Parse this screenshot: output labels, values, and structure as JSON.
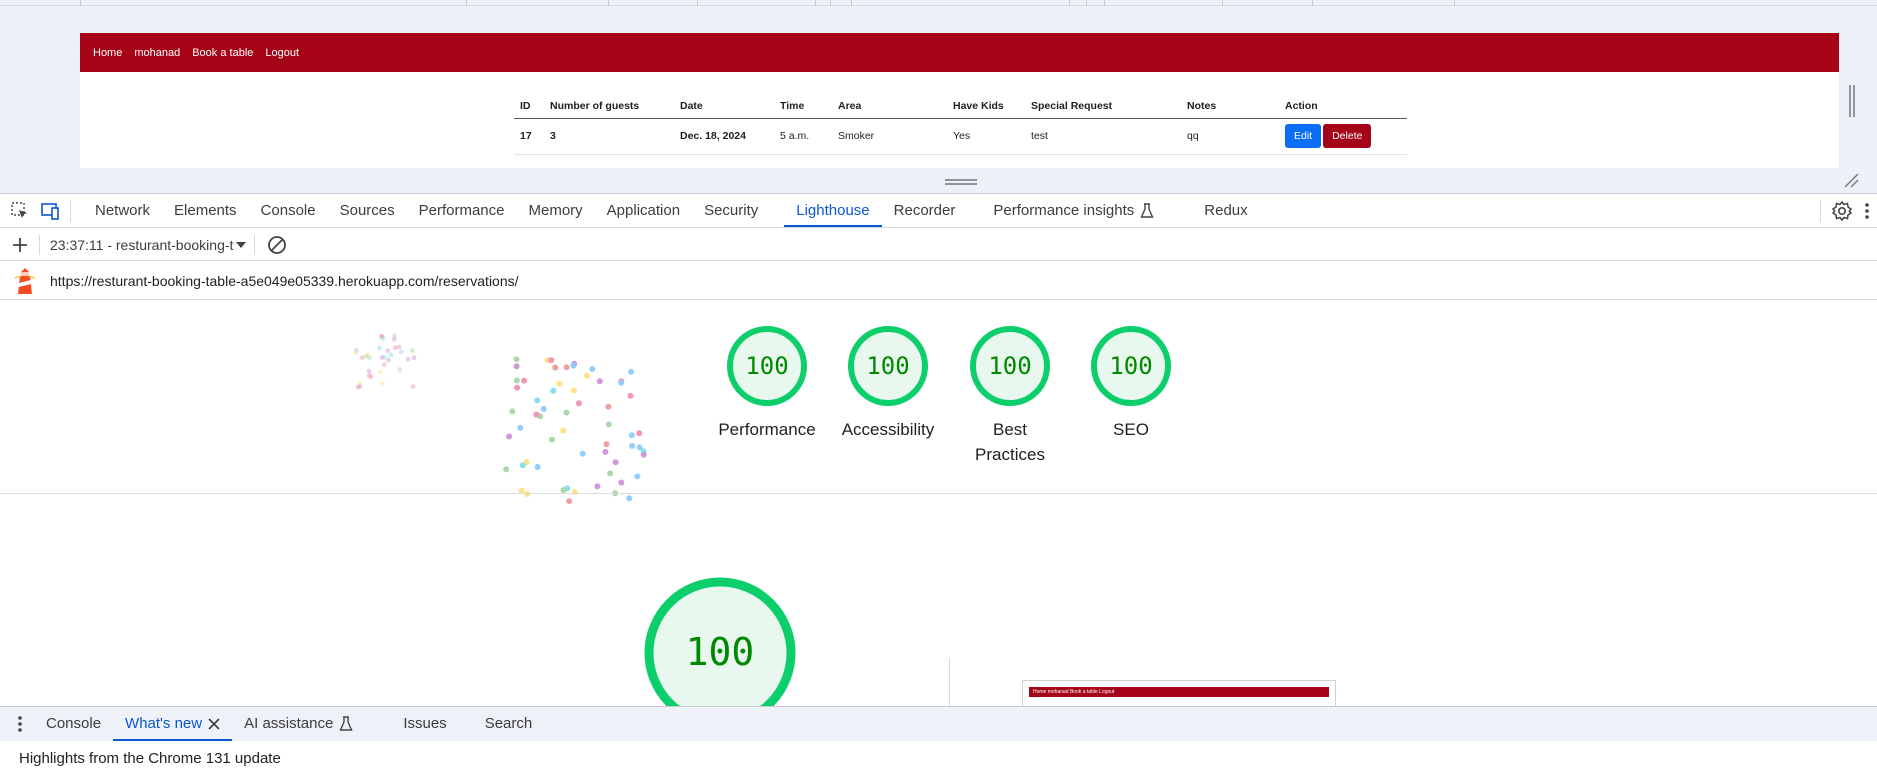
{
  "site": {
    "nav": [
      "Home",
      "mohanad",
      "Book a table",
      "Logout"
    ],
    "table": {
      "headers": [
        "ID",
        "Number of guests",
        "Date",
        "Time",
        "Area",
        "Have Kids",
        "Special Request",
        "Notes",
        "Action"
      ],
      "rows": [
        {
          "id": "17",
          "guests": "3",
          "date": "Dec. 18, 2024",
          "time": "5 a.m.",
          "area": "Smoker",
          "kids": "Yes",
          "request": "test",
          "notes": "qq",
          "edit": "Edit",
          "delete": "Delete"
        }
      ]
    }
  },
  "devtools": {
    "tabs": [
      "Network",
      "Elements",
      "Console",
      "Sources",
      "Performance",
      "Memory",
      "Application",
      "Security",
      "Lighthouse",
      "Recorder",
      "Performance insights",
      "Redux"
    ],
    "active_tab": "Lighthouse",
    "icons": {
      "inspect": "inspect-element-icon",
      "device": "device-toolbar-icon",
      "settings": "gear-icon",
      "more": "more-vert-icon",
      "flask": "experiment-flask-icon"
    }
  },
  "lighthouse": {
    "report_select": "23:37:11 - resturant-booking-t",
    "url": "https://resturant-booking-table-a5e049e05339.herokuapp.com/reservations/",
    "scores": [
      {
        "label": "Performance",
        "score": 100
      },
      {
        "label": "Accessibility",
        "score": 100
      },
      {
        "label": "Best Practices",
        "score": 100
      },
      {
        "label": "SEO",
        "score": 100
      }
    ],
    "main_score": 100,
    "colors": {
      "pass": "#0cce6b",
      "pass_fill": "#e8f8ee",
      "pass_text": "#008800"
    },
    "thumbnail_nav": "Home  mohanad  Book a table  Logout"
  },
  "drawer": {
    "tabs": [
      "Console",
      "What's new",
      "AI assistance",
      "Issues",
      "Search"
    ],
    "active_tab": "What's new",
    "body": "Highlights from the Chrome 131 update"
  }
}
